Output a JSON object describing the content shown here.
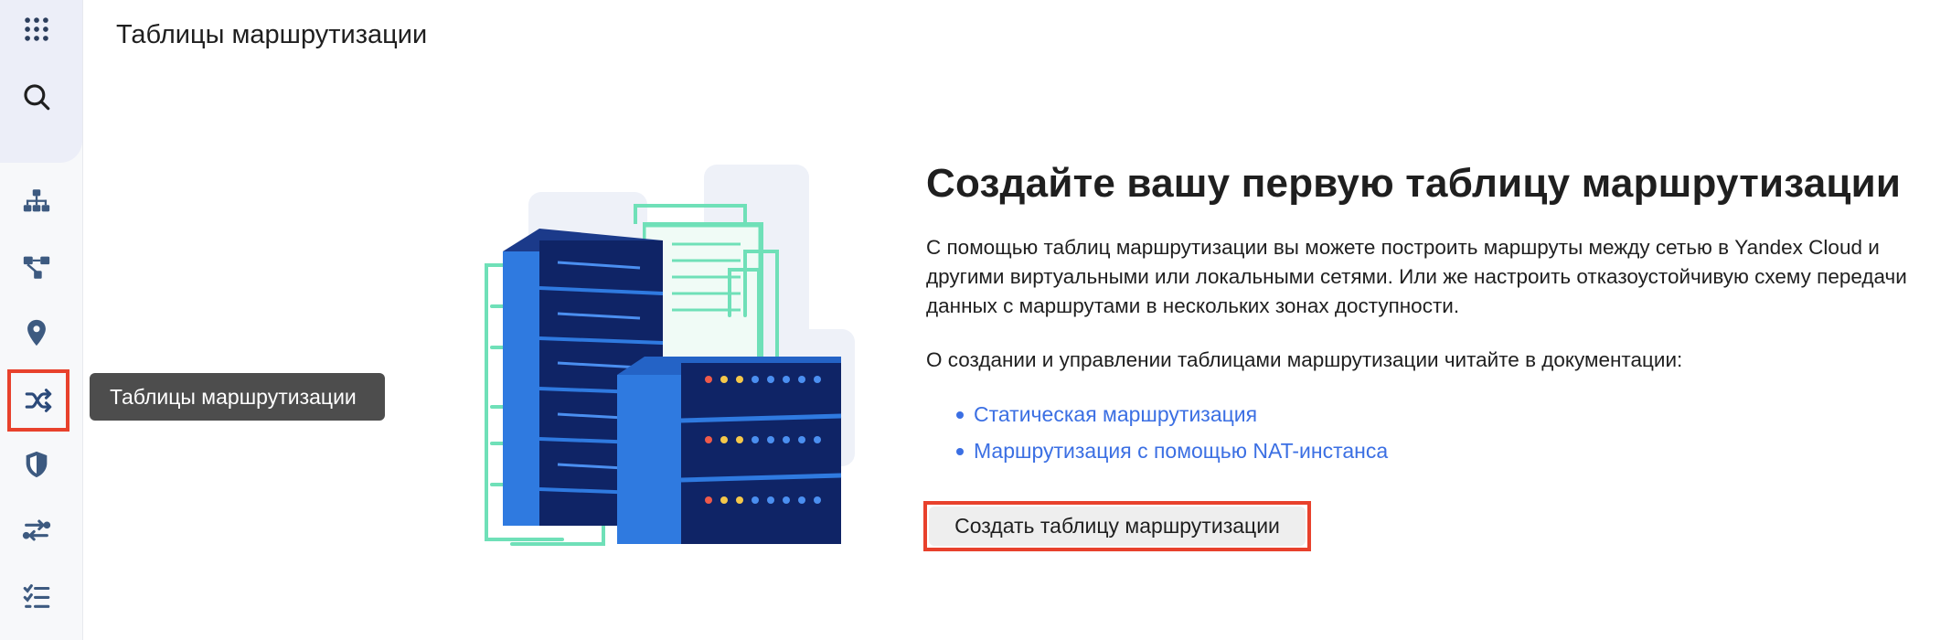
{
  "header": {
    "title": "Таблицы маршрутизации"
  },
  "sidebar": {
    "items": [
      {
        "name": "apps-grid-icon"
      },
      {
        "name": "search-icon"
      },
      {
        "name": "cloud-networks-icon"
      },
      {
        "name": "subnets-icon"
      },
      {
        "name": "ip-addresses-icon"
      },
      {
        "name": "routing-tables-icon",
        "active": true
      },
      {
        "name": "security-groups-icon"
      },
      {
        "name": "gateways-icon"
      },
      {
        "name": "operations-icon"
      }
    ],
    "tooltip": "Таблицы маршрутизации"
  },
  "empty_state": {
    "headline": "Создайте вашу первую таблицу маршрутизации",
    "description": "С помощью таблиц маршрутизации вы можете построить маршруты между сетью в Yandex Cloud и другими виртуальными или локальными сетями. Или же настроить отказоустойчивую схему передачи данных с маршрутами в нескольких зонах доступности.",
    "docs_intro": "О создании и управлении таблицами маршрутизации читайте в документации:",
    "links": [
      "Статическая маршрутизация",
      "Маршрутизация с помощью NAT-инстанса"
    ],
    "create_button": "Создать таблицу маршрутизации"
  },
  "colors": {
    "accent_link": "#3b6fe3",
    "highlight_frame": "#e8412c",
    "server_dark": "#0f2466",
    "server_blue": "#2f7ae0",
    "cable_mint": "#6fe0b8"
  }
}
